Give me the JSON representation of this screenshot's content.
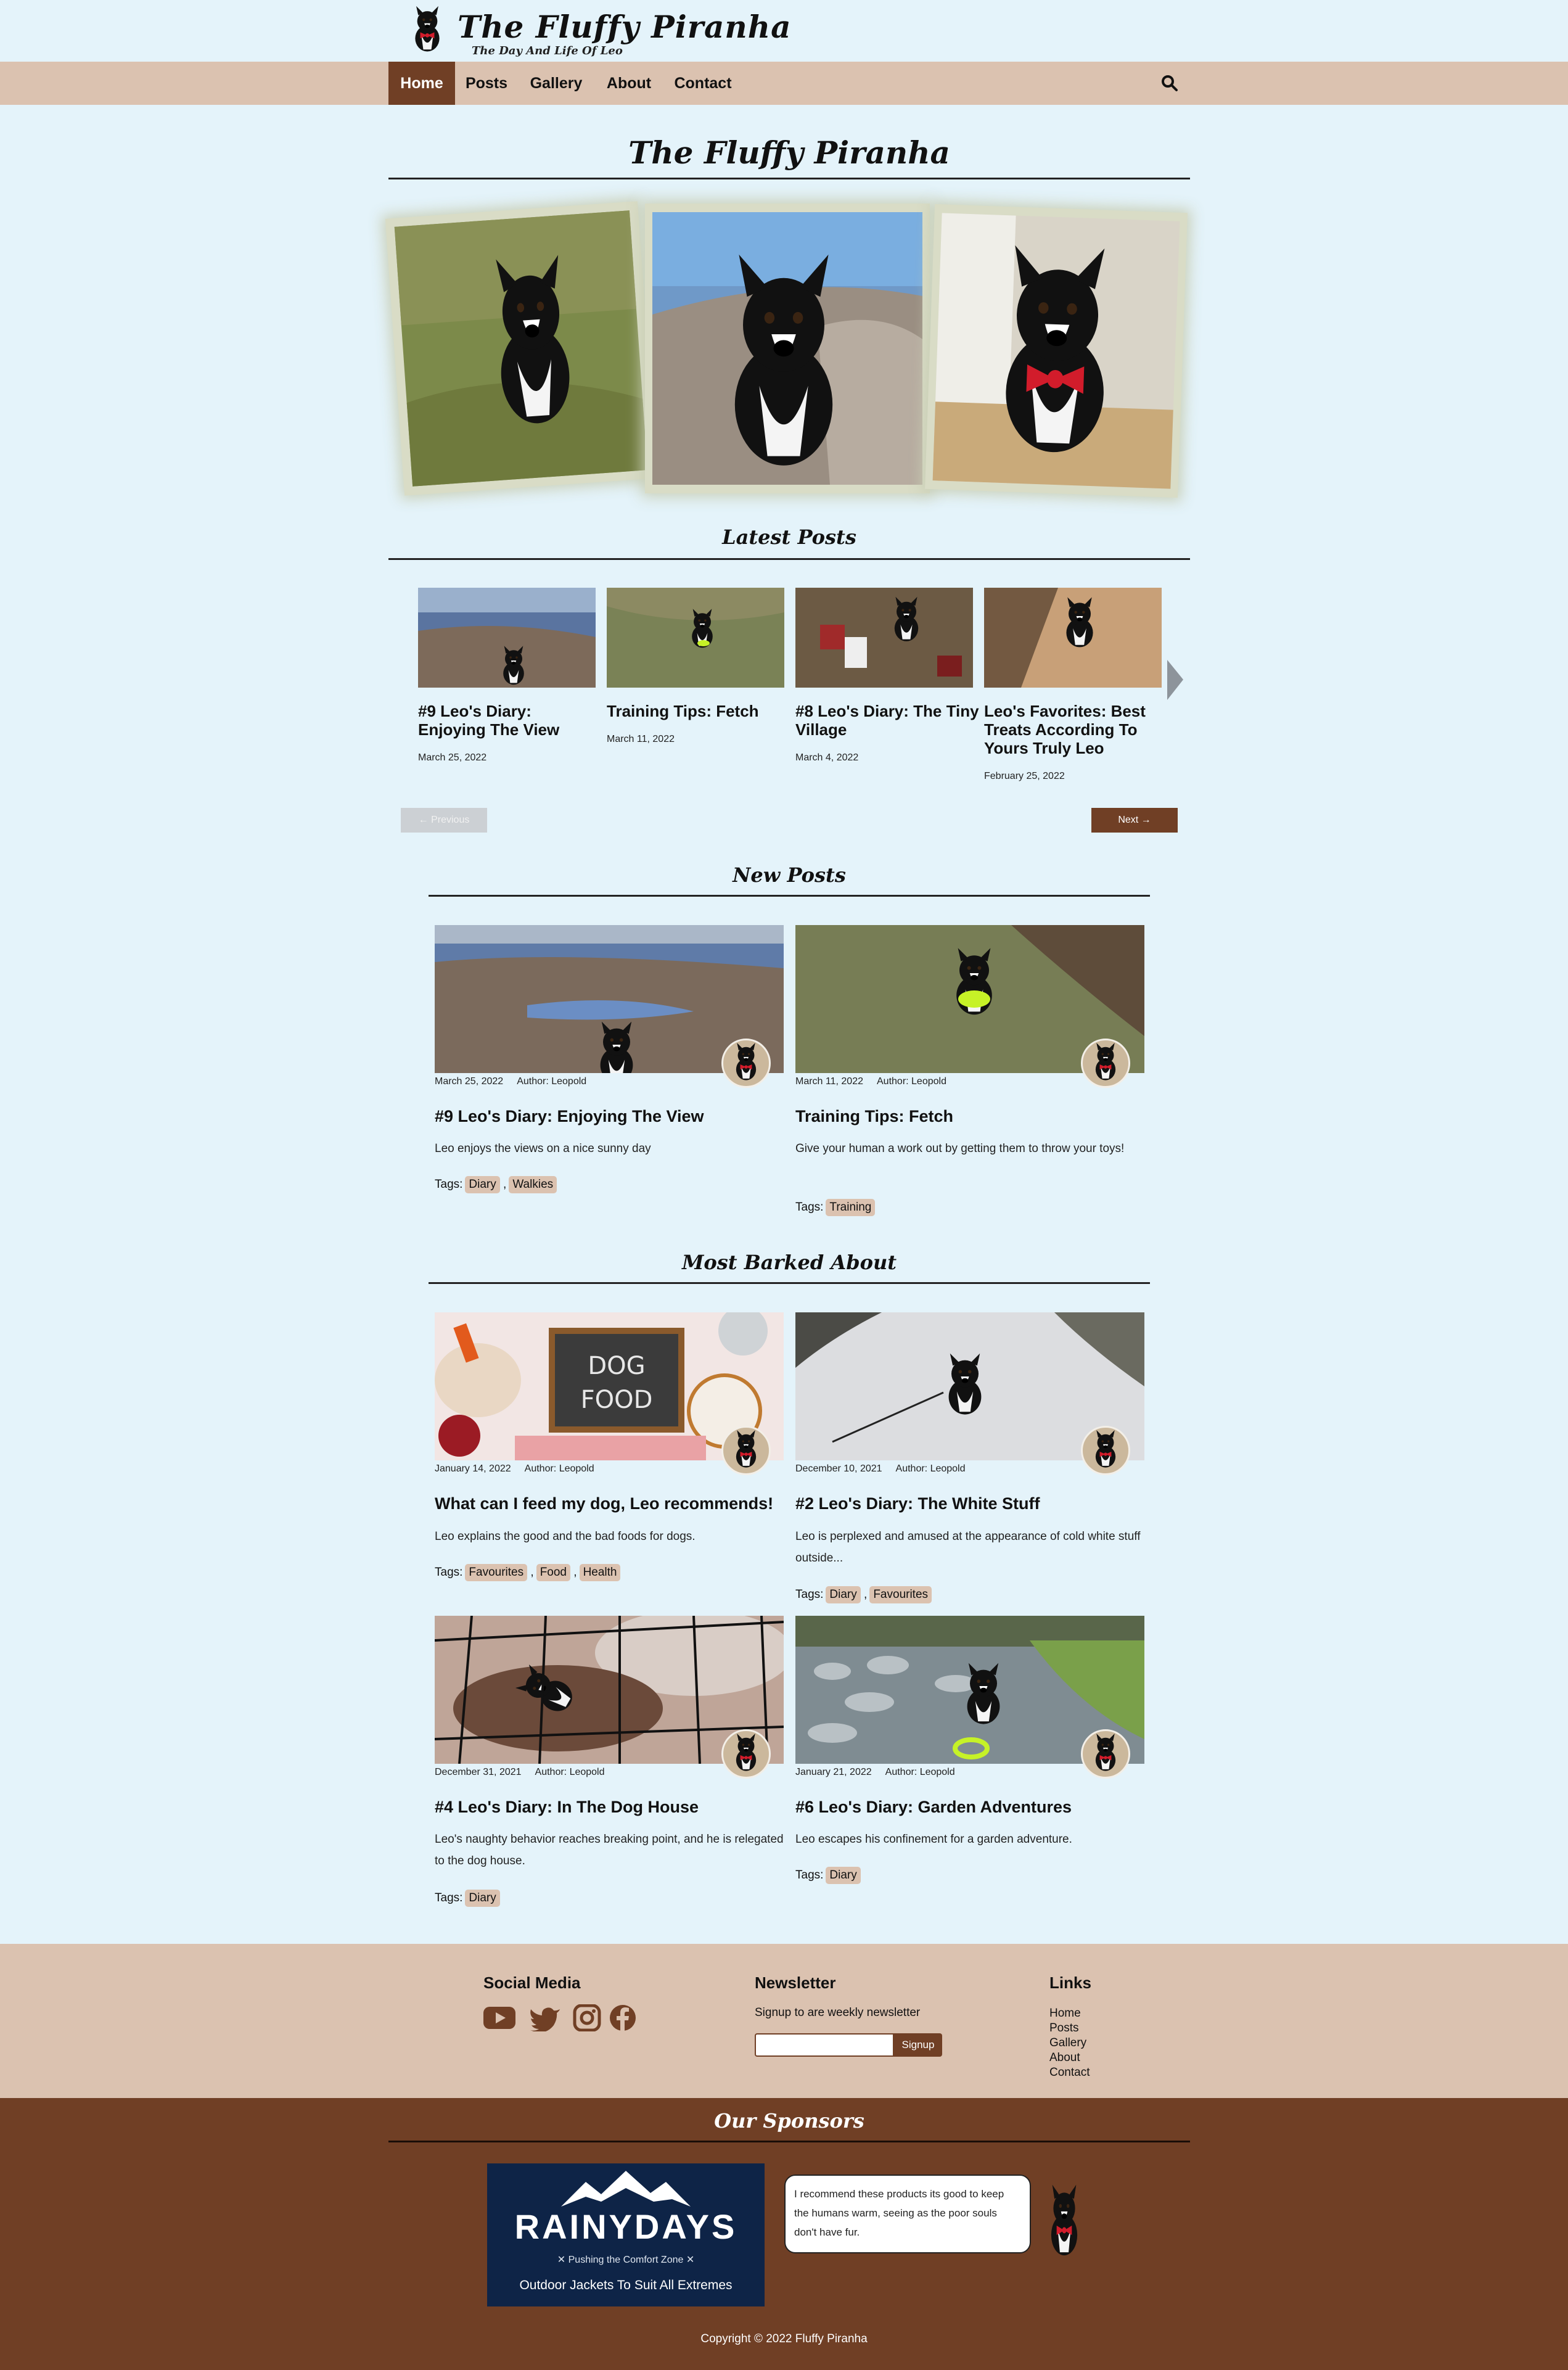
{
  "header": {
    "title": "The Fluffy Piranha",
    "tagline": "The Day And Life Of Leo"
  },
  "nav": {
    "items": [
      "Home",
      "Posts",
      "Gallery",
      "About",
      "Contact"
    ],
    "active": "Home"
  },
  "hero": {
    "title": "The Fluffy Piranha"
  },
  "latest_posts": {
    "title": "Latest Posts",
    "cards": [
      {
        "title": "#9 Leo's Diary: Enjoying The View",
        "date": "March 25, 2022"
      },
      {
        "title": "Training Tips: Fetch",
        "date": "March 11, 2022"
      },
      {
        "title": "#8 Leo's Diary: The Tiny Village",
        "date": "March 4, 2022"
      },
      {
        "title": "Leo's Favorites: Best Treats According To Yours Truly Leo",
        "date": "February 25, 2022"
      }
    ],
    "prev_label": "← Previous",
    "next_label": "Next →"
  },
  "new_posts": {
    "title": "New Posts",
    "posts": [
      {
        "date": "March 25, 2022",
        "author": "Author: Leopold",
        "title": "#9 Leo's Diary: Enjoying The View",
        "excerpt": "Leo enjoys the views on a nice sunny day",
        "tags_label": "Tags:",
        "tags": [
          "Diary",
          "Walkies"
        ]
      },
      {
        "date": "March 11, 2022",
        "author": "Author: Leopold",
        "title": "Training Tips: Fetch",
        "excerpt": "Give your human a work out by getting them to throw your toys!",
        "tags_label": "Tags:",
        "tags": [
          "Training"
        ]
      }
    ]
  },
  "most_barked": {
    "title": "Most Barked About",
    "posts": [
      {
        "date": "January 14, 2022",
        "author": "Author: Leopold",
        "title": "What can I feed my dog, Leo recommends!",
        "excerpt": "Leo explains the good and the bad foods for dogs.",
        "tags_label": "Tags:",
        "tags": [
          "Favourites",
          "Food",
          "Health"
        ],
        "image_text": "DOG FOOD"
      },
      {
        "date": "December 10, 2021",
        "author": "Author: Leopold",
        "title": "#2 Leo's Diary: The White Stuff",
        "excerpt": "Leo is perplexed and amused at the appearance of cold white stuff outside...",
        "tags_label": "Tags:",
        "tags": [
          "Diary",
          "Favourites"
        ]
      },
      {
        "date": "December 31, 2021",
        "author": "Author: Leopold",
        "title": "#4 Leo's Diary: In The Dog House",
        "excerpt": "Leo's naughty behavior reaches breaking point, and he is relegated to the dog house.",
        "tags_label": "Tags:",
        "tags": [
          "Diary"
        ]
      },
      {
        "date": "January 21, 2022",
        "author": "Author: Leopold",
        "title": "#6 Leo's Diary: Garden Adventures",
        "excerpt": "Leo escapes his confinement for a garden adventure.",
        "tags_label": "Tags:",
        "tags": [
          "Diary"
        ]
      }
    ]
  },
  "footer": {
    "social_title": "Social Media",
    "social_icons": [
      "youtube-icon",
      "twitter-icon",
      "instagram-icon",
      "facebook-icon"
    ],
    "newsletter_title": "Newsletter",
    "newsletter_text": "Signup to are weekly newsletter",
    "signup_label": "Signup",
    "links_title": "Links",
    "links": [
      "Home",
      "Posts",
      "Gallery",
      "About",
      "Contact"
    ]
  },
  "sponsors": {
    "title": "Our Sponsors",
    "ad_brand": "RAINYDAYS",
    "ad_slogan": "✕ Pushing the Comfort Zone ✕",
    "ad_caption": "Outdoor Jackets To Suit All Extremes",
    "quote": "I recommend these products its good to keep the humans warm, seeing as the poor souls don't have fur.",
    "copyright": "Copyright © 2022 Fluffy Piranha"
  },
  "colors": {
    "page_bg": "#e4f3fa",
    "nav_bg": "#dbc2b0",
    "accent": "#703f25",
    "tag_bg": "#dbc2b0"
  }
}
